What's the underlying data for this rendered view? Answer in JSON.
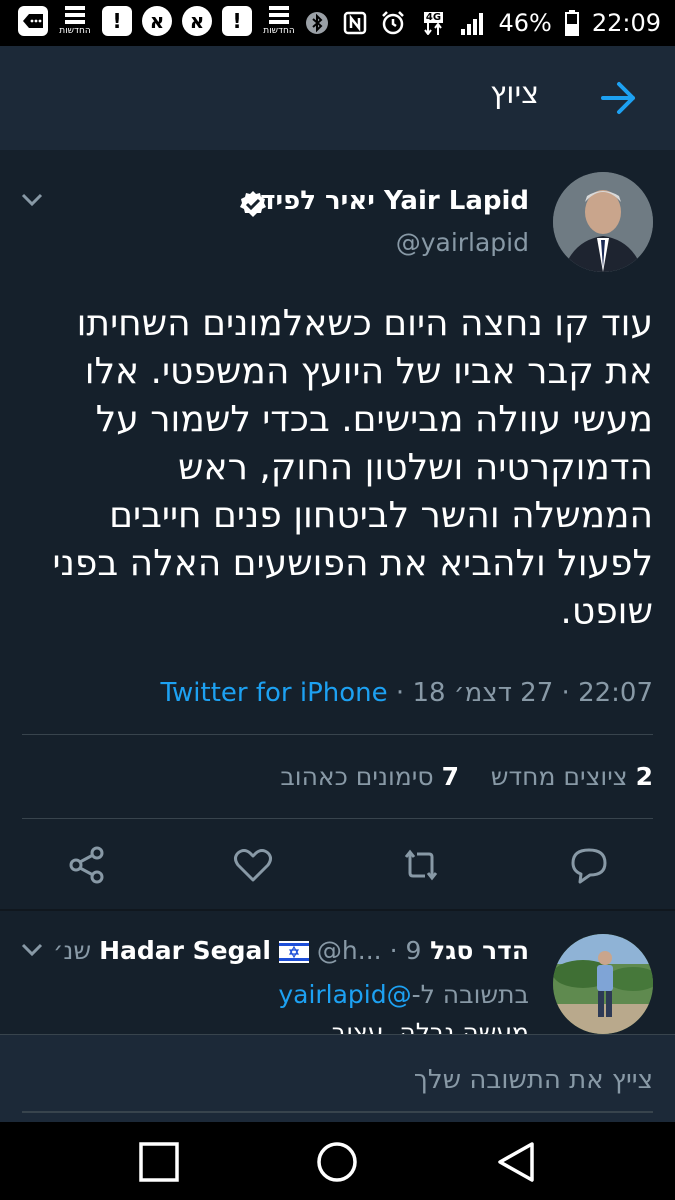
{
  "status_bar": {
    "notification_icons": [
      "messages-icon",
      "news-icon",
      "alert-icon",
      "app-icon",
      "app-icon",
      "alert-icon",
      "news-icon"
    ],
    "news_label": "החדשות",
    "battery": "46%",
    "time": "22:09",
    "network": "4G"
  },
  "header": {
    "title": "ציוץ"
  },
  "tweet": {
    "author_name": "יאיר לפיד Yair Lapid",
    "handle": "@yairlapid",
    "text": "עוד קו נחצה היום כשאלמונים השחיתו את קבר אביו של היועץ המשפטי. אלו מעשי עוולה מבישים. בכדי לשמור על הדמוקרטיה ושלטון החוק, ראש הממשלה והשר לביטחון פנים חייבים לפעול ולהביא את הפושעים האלה בפני שופט.",
    "time": "22:07",
    "date": "27 דצמ׳ 18",
    "source": "Twitter for iPhone",
    "separator": "·",
    "retweets_count": "2",
    "retweets_label": "ציוצים מחדש",
    "likes_count": "7",
    "likes_label": "סימונים כאהוב"
  },
  "reply": {
    "author_name": "הדר סגל Hadar Segal",
    "handle": "@h...",
    "age": "9 שנ׳",
    "in_reply_prefix": "בתשובה ל-",
    "in_reply_handle": "@yairlapid",
    "text_partial": "מעשה נבלה, עצוב"
  },
  "compose": {
    "placeholder": "צייץ את התשובה שלך"
  },
  "colors": {
    "background": "#15202b",
    "header": "#1c2938",
    "accent": "#1da1f2",
    "secondary_text": "#8899a6",
    "divider": "#38444d"
  }
}
